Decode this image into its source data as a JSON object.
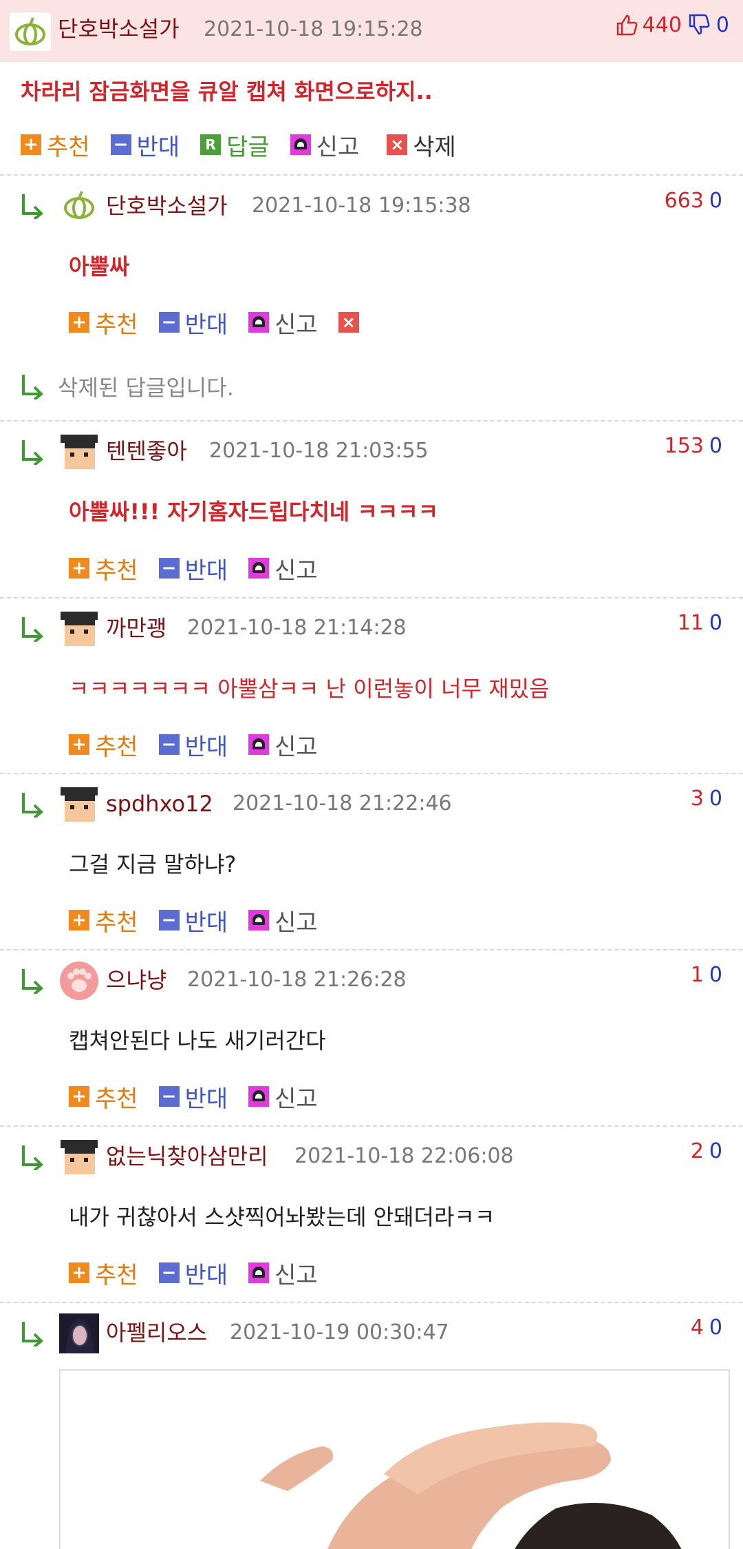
{
  "post": {
    "author": "단호박소설가",
    "date": "2021-10-18 19:15:28",
    "up": "440",
    "down": "0",
    "title": "차라리 잠금화면을 큐알 캡쳐 화면으로하지..",
    "actions": {
      "recommend": "추천",
      "oppose": "반대",
      "reply": "답글",
      "report": "신고",
      "delete": "삭제"
    }
  },
  "labels": {
    "recommend": "추천",
    "oppose": "반대",
    "report": "신고"
  },
  "comments": [
    {
      "author": "단호박소설가",
      "date": "2021-10-18 19:15:38",
      "up": "663",
      "down": "0",
      "text": "아뿔싸"
    },
    {
      "deleted_text": "삭제된 답글입니다."
    },
    {
      "author": "텐텐좋아",
      "date": "2021-10-18 21:03:55",
      "up": "153",
      "down": "0",
      "text": "아뿔싸!!! 자기홈자드립다치네 ㅋㅋㅋㅋ"
    },
    {
      "author": "까만괭",
      "date": "2021-10-18 21:14:28",
      "up": "11",
      "down": "0",
      "text": "ㅋㅋㅋㅋㅋㅋㅋ 아뿔삼ㅋㅋ 난 이런놓이 너무 재밌음"
    },
    {
      "author": "spdhxo12",
      "date": "2021-10-18 21:22:46",
      "up": "3",
      "down": "0",
      "text": "그걸 지금 말하냐?"
    },
    {
      "author": "으냐냥",
      "date": "2021-10-18 21:26:28",
      "up": "1",
      "down": "0",
      "text": "캡쳐안된다 나도 새기러간다"
    },
    {
      "author": "없는닉찾아삼만리",
      "date": "2021-10-18 22:06:08",
      "up": "2",
      "down": "0",
      "text": "내가 귀찮아서 스샷찍어놔봤는데 안돼더라ㅋㅋ"
    },
    {
      "author": "아펠리오스",
      "date": "2021-10-19 00:30:47",
      "up": "4",
      "down": "0"
    }
  ],
  "colors": {
    "header_bg": "#fde4e4",
    "accent_red": "#d0252a",
    "author": "#7a1414",
    "down_blue": "#2336c9"
  }
}
